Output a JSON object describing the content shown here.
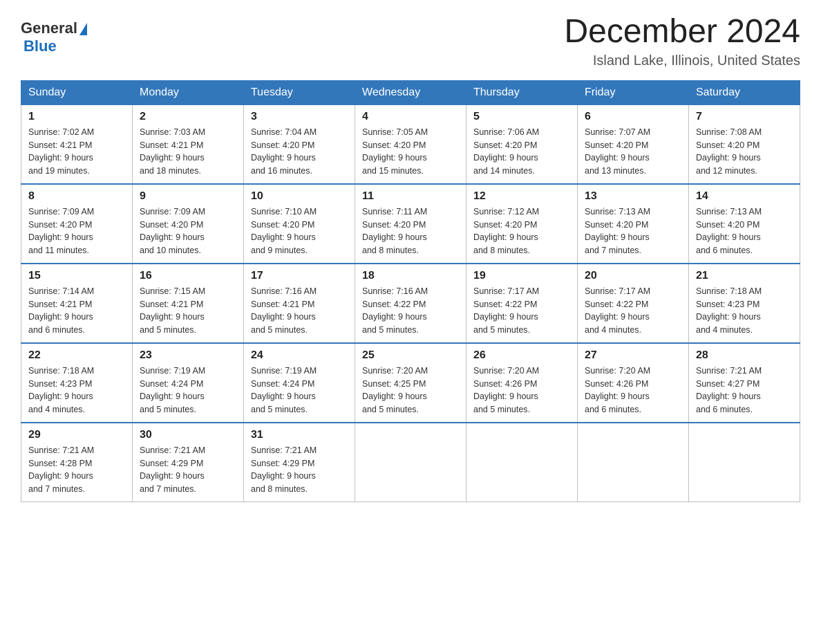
{
  "header": {
    "logo": {
      "general": "General",
      "blue": "Blue"
    },
    "title": "December 2024",
    "location": "Island Lake, Illinois, United States"
  },
  "calendar": {
    "days_of_week": [
      "Sunday",
      "Monday",
      "Tuesday",
      "Wednesday",
      "Thursday",
      "Friday",
      "Saturday"
    ],
    "weeks": [
      [
        {
          "day": "1",
          "sunrise": "7:02 AM",
          "sunset": "4:21 PM",
          "daylight": "9 hours and 19 minutes."
        },
        {
          "day": "2",
          "sunrise": "7:03 AM",
          "sunset": "4:21 PM",
          "daylight": "9 hours and 18 minutes."
        },
        {
          "day": "3",
          "sunrise": "7:04 AM",
          "sunset": "4:20 PM",
          "daylight": "9 hours and 16 minutes."
        },
        {
          "day": "4",
          "sunrise": "7:05 AM",
          "sunset": "4:20 PM",
          "daylight": "9 hours and 15 minutes."
        },
        {
          "day": "5",
          "sunrise": "7:06 AM",
          "sunset": "4:20 PM",
          "daylight": "9 hours and 14 minutes."
        },
        {
          "day": "6",
          "sunrise": "7:07 AM",
          "sunset": "4:20 PM",
          "daylight": "9 hours and 13 minutes."
        },
        {
          "day": "7",
          "sunrise": "7:08 AM",
          "sunset": "4:20 PM",
          "daylight": "9 hours and 12 minutes."
        }
      ],
      [
        {
          "day": "8",
          "sunrise": "7:09 AM",
          "sunset": "4:20 PM",
          "daylight": "9 hours and 11 minutes."
        },
        {
          "day": "9",
          "sunrise": "7:09 AM",
          "sunset": "4:20 PM",
          "daylight": "9 hours and 10 minutes."
        },
        {
          "day": "10",
          "sunrise": "7:10 AM",
          "sunset": "4:20 PM",
          "daylight": "9 hours and 9 minutes."
        },
        {
          "day": "11",
          "sunrise": "7:11 AM",
          "sunset": "4:20 PM",
          "daylight": "9 hours and 8 minutes."
        },
        {
          "day": "12",
          "sunrise": "7:12 AM",
          "sunset": "4:20 PM",
          "daylight": "9 hours and 8 minutes."
        },
        {
          "day": "13",
          "sunrise": "7:13 AM",
          "sunset": "4:20 PM",
          "daylight": "9 hours and 7 minutes."
        },
        {
          "day": "14",
          "sunrise": "7:13 AM",
          "sunset": "4:20 PM",
          "daylight": "9 hours and 6 minutes."
        }
      ],
      [
        {
          "day": "15",
          "sunrise": "7:14 AM",
          "sunset": "4:21 PM",
          "daylight": "9 hours and 6 minutes."
        },
        {
          "day": "16",
          "sunrise": "7:15 AM",
          "sunset": "4:21 PM",
          "daylight": "9 hours and 5 minutes."
        },
        {
          "day": "17",
          "sunrise": "7:16 AM",
          "sunset": "4:21 PM",
          "daylight": "9 hours and 5 minutes."
        },
        {
          "day": "18",
          "sunrise": "7:16 AM",
          "sunset": "4:22 PM",
          "daylight": "9 hours and 5 minutes."
        },
        {
          "day": "19",
          "sunrise": "7:17 AM",
          "sunset": "4:22 PM",
          "daylight": "9 hours and 5 minutes."
        },
        {
          "day": "20",
          "sunrise": "7:17 AM",
          "sunset": "4:22 PM",
          "daylight": "9 hours and 4 minutes."
        },
        {
          "day": "21",
          "sunrise": "7:18 AM",
          "sunset": "4:23 PM",
          "daylight": "9 hours and 4 minutes."
        }
      ],
      [
        {
          "day": "22",
          "sunrise": "7:18 AM",
          "sunset": "4:23 PM",
          "daylight": "9 hours and 4 minutes."
        },
        {
          "day": "23",
          "sunrise": "7:19 AM",
          "sunset": "4:24 PM",
          "daylight": "9 hours and 5 minutes."
        },
        {
          "day": "24",
          "sunrise": "7:19 AM",
          "sunset": "4:24 PM",
          "daylight": "9 hours and 5 minutes."
        },
        {
          "day": "25",
          "sunrise": "7:20 AM",
          "sunset": "4:25 PM",
          "daylight": "9 hours and 5 minutes."
        },
        {
          "day": "26",
          "sunrise": "7:20 AM",
          "sunset": "4:26 PM",
          "daylight": "9 hours and 5 minutes."
        },
        {
          "day": "27",
          "sunrise": "7:20 AM",
          "sunset": "4:26 PM",
          "daylight": "9 hours and 6 minutes."
        },
        {
          "day": "28",
          "sunrise": "7:21 AM",
          "sunset": "4:27 PM",
          "daylight": "9 hours and 6 minutes."
        }
      ],
      [
        {
          "day": "29",
          "sunrise": "7:21 AM",
          "sunset": "4:28 PM",
          "daylight": "9 hours and 7 minutes."
        },
        {
          "day": "30",
          "sunrise": "7:21 AM",
          "sunset": "4:29 PM",
          "daylight": "9 hours and 7 minutes."
        },
        {
          "day": "31",
          "sunrise": "7:21 AM",
          "sunset": "4:29 PM",
          "daylight": "9 hours and 8 minutes."
        },
        null,
        null,
        null,
        null
      ]
    ]
  },
  "labels": {
    "sunrise": "Sunrise:",
    "sunset": "Sunset:",
    "daylight": "Daylight:"
  }
}
